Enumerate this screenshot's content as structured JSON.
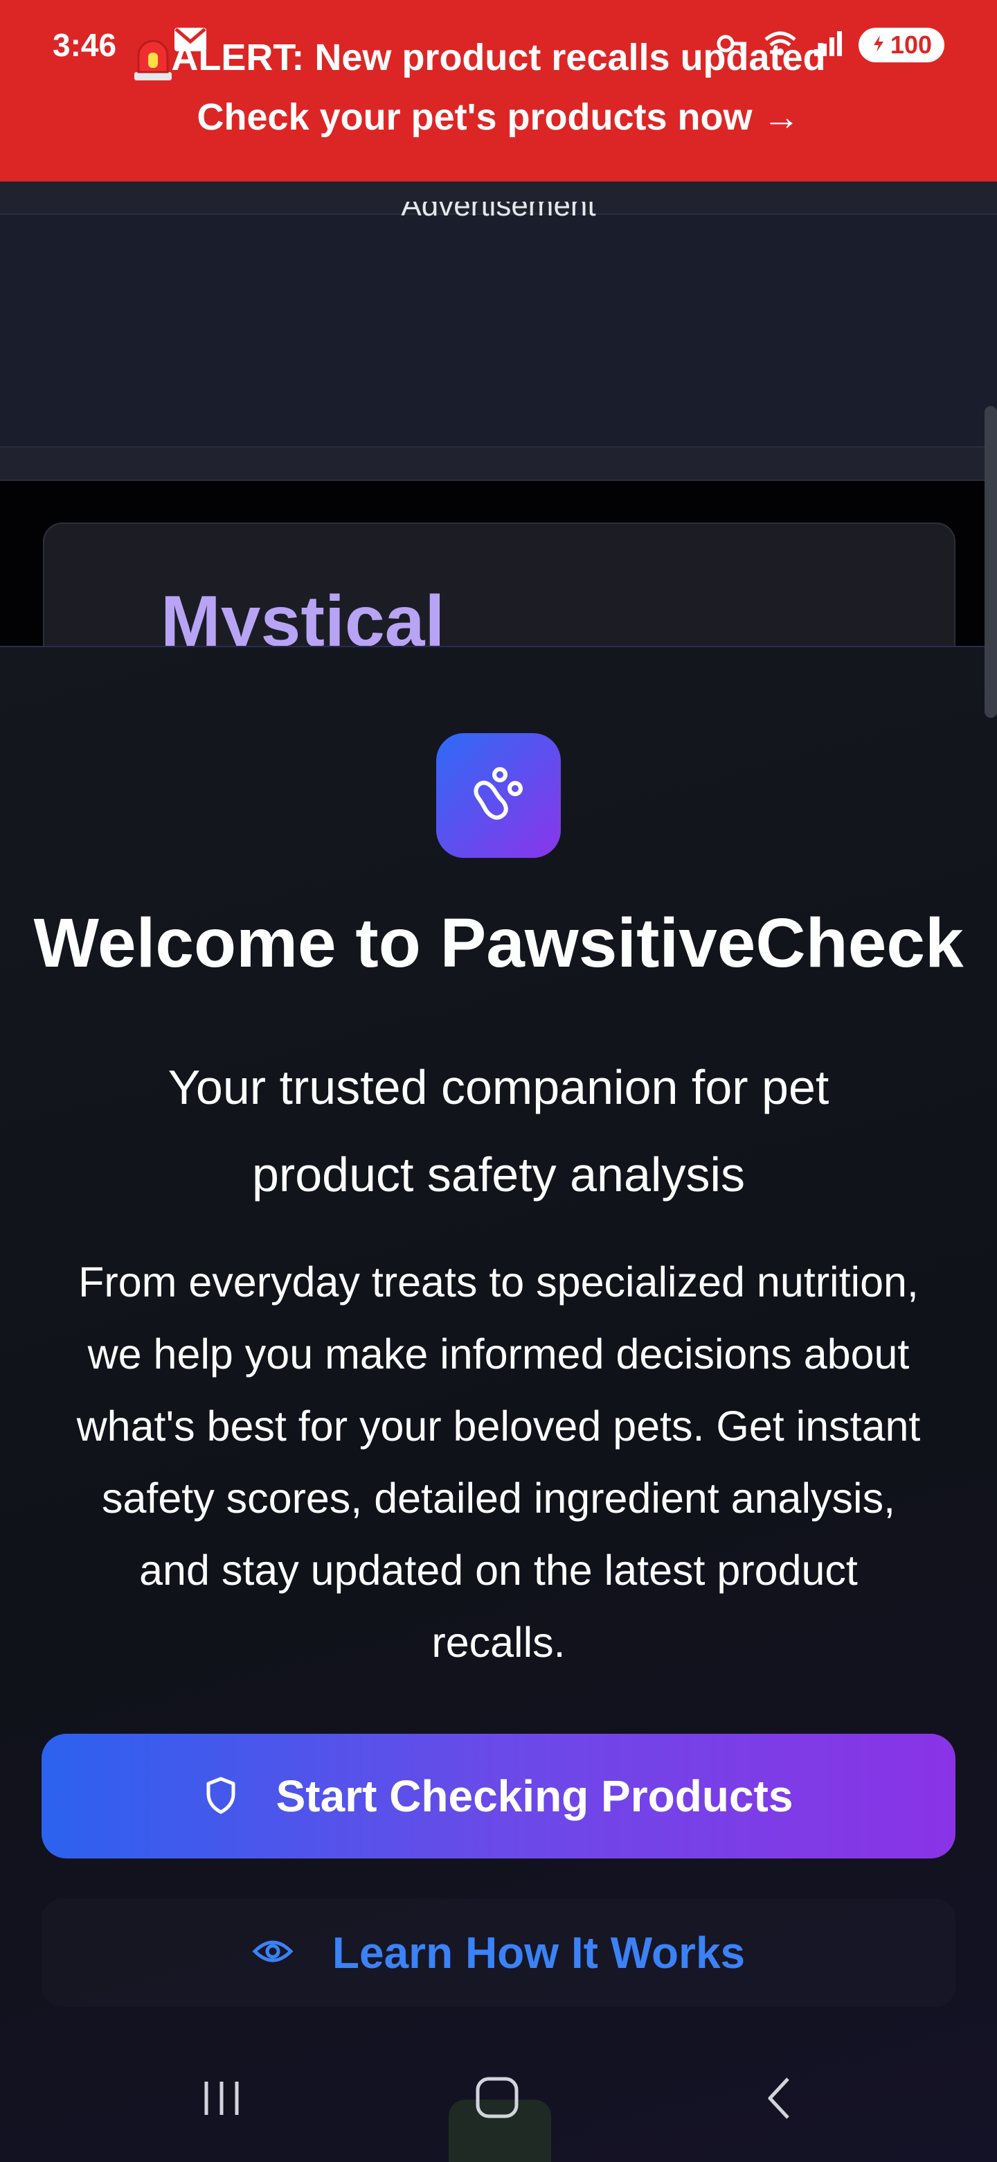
{
  "status_bar": {
    "time": "3:46",
    "battery": "100",
    "icons": [
      "siren-icon",
      "gmail-icon",
      "key-icon",
      "wifi-icon",
      "signal-icon",
      "battery-icon"
    ]
  },
  "alert": {
    "line1": "ALERT: New product recalls updated",
    "line2": "Check your pet's products now →",
    "background": "#dc2626"
  },
  "ad": {
    "label": "Advertisement"
  },
  "background_card": {
    "title": "Mystical"
  },
  "welcome": {
    "logo_icon": "paw-icon",
    "title": "Welcome to PawsitiveCheck",
    "tagline": "Your trusted companion for pet product safety analysis",
    "description": "From everyday treats to specialized nutrition, we help you make informed decisions about what's best for your beloved pets. Get instant safety scores, detailed ingredient analysis, and stay updated on the latest product recalls.",
    "primary_button": {
      "label": "Start Checking Products",
      "icon": "shield-icon"
    },
    "secondary_button": {
      "label": "Learn How It Works",
      "icon": "eye-icon"
    }
  },
  "colors": {
    "accent_gradient_start": "#2c62ef",
    "accent_gradient_end": "#8a33e6",
    "link_blue": "#3b82f6",
    "card_title": "#b8a4f5"
  },
  "nav": {
    "buttons": [
      "recents-icon",
      "home-icon",
      "back-icon"
    ]
  }
}
